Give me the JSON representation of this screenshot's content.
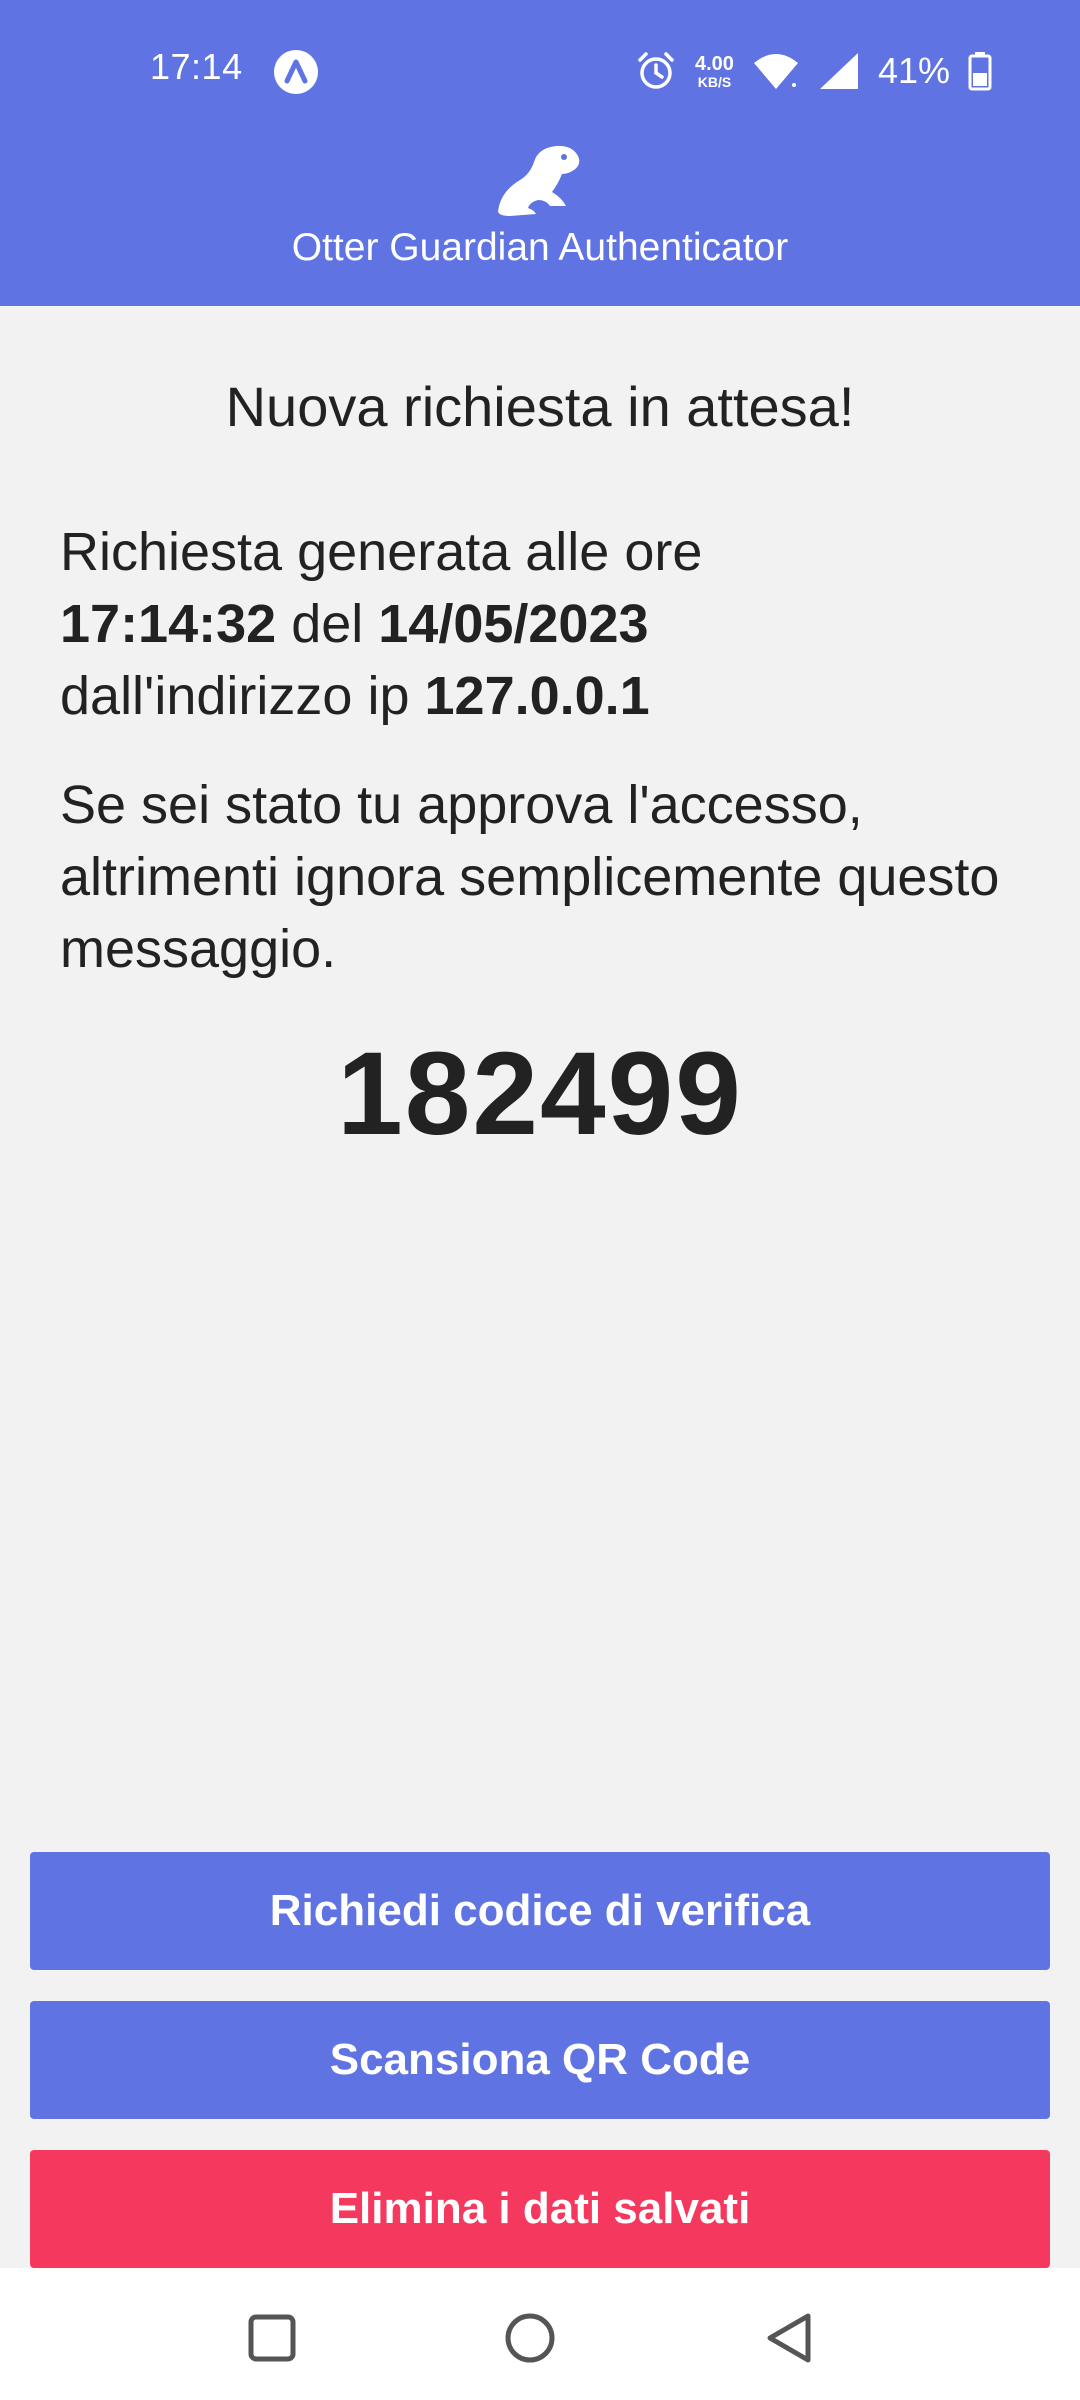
{
  "status_bar": {
    "time": "17:14",
    "net_speed_value": "4.00",
    "net_speed_unit": "KB/S",
    "battery_percent": "41%",
    "icons": [
      "vpn-icon",
      "alarm-icon",
      "wifi-icon",
      "signal-icon",
      "battery-icon"
    ]
  },
  "header": {
    "logo_icon": "otter-icon",
    "app_title": "Otter Guardian Authenticator",
    "background_color": "#5f73e3"
  },
  "request": {
    "title": "Nuova richiesta in attesa!",
    "line1": "Richiesta generata alle ore",
    "time": "17:14:32",
    "del_text": "del",
    "date": "14/05/2023",
    "ip_prefix": "dall'indirizzo ip",
    "ip": "127.0.0.1",
    "instructions": "Se sei stato tu approva l'accesso, altrimenti ignora semplicemente questo messaggio.",
    "code": "182499"
  },
  "actions": {
    "verify_label": "Richiedi codice di verifica",
    "scan_label": "Scansiona QR Code",
    "delete_label": "Elimina i dati salvati",
    "primary_color": "#5f73e3",
    "danger_color": "#f5385e"
  },
  "navbar": {
    "icons": [
      "recent-apps-icon",
      "home-icon",
      "back-icon"
    ]
  }
}
